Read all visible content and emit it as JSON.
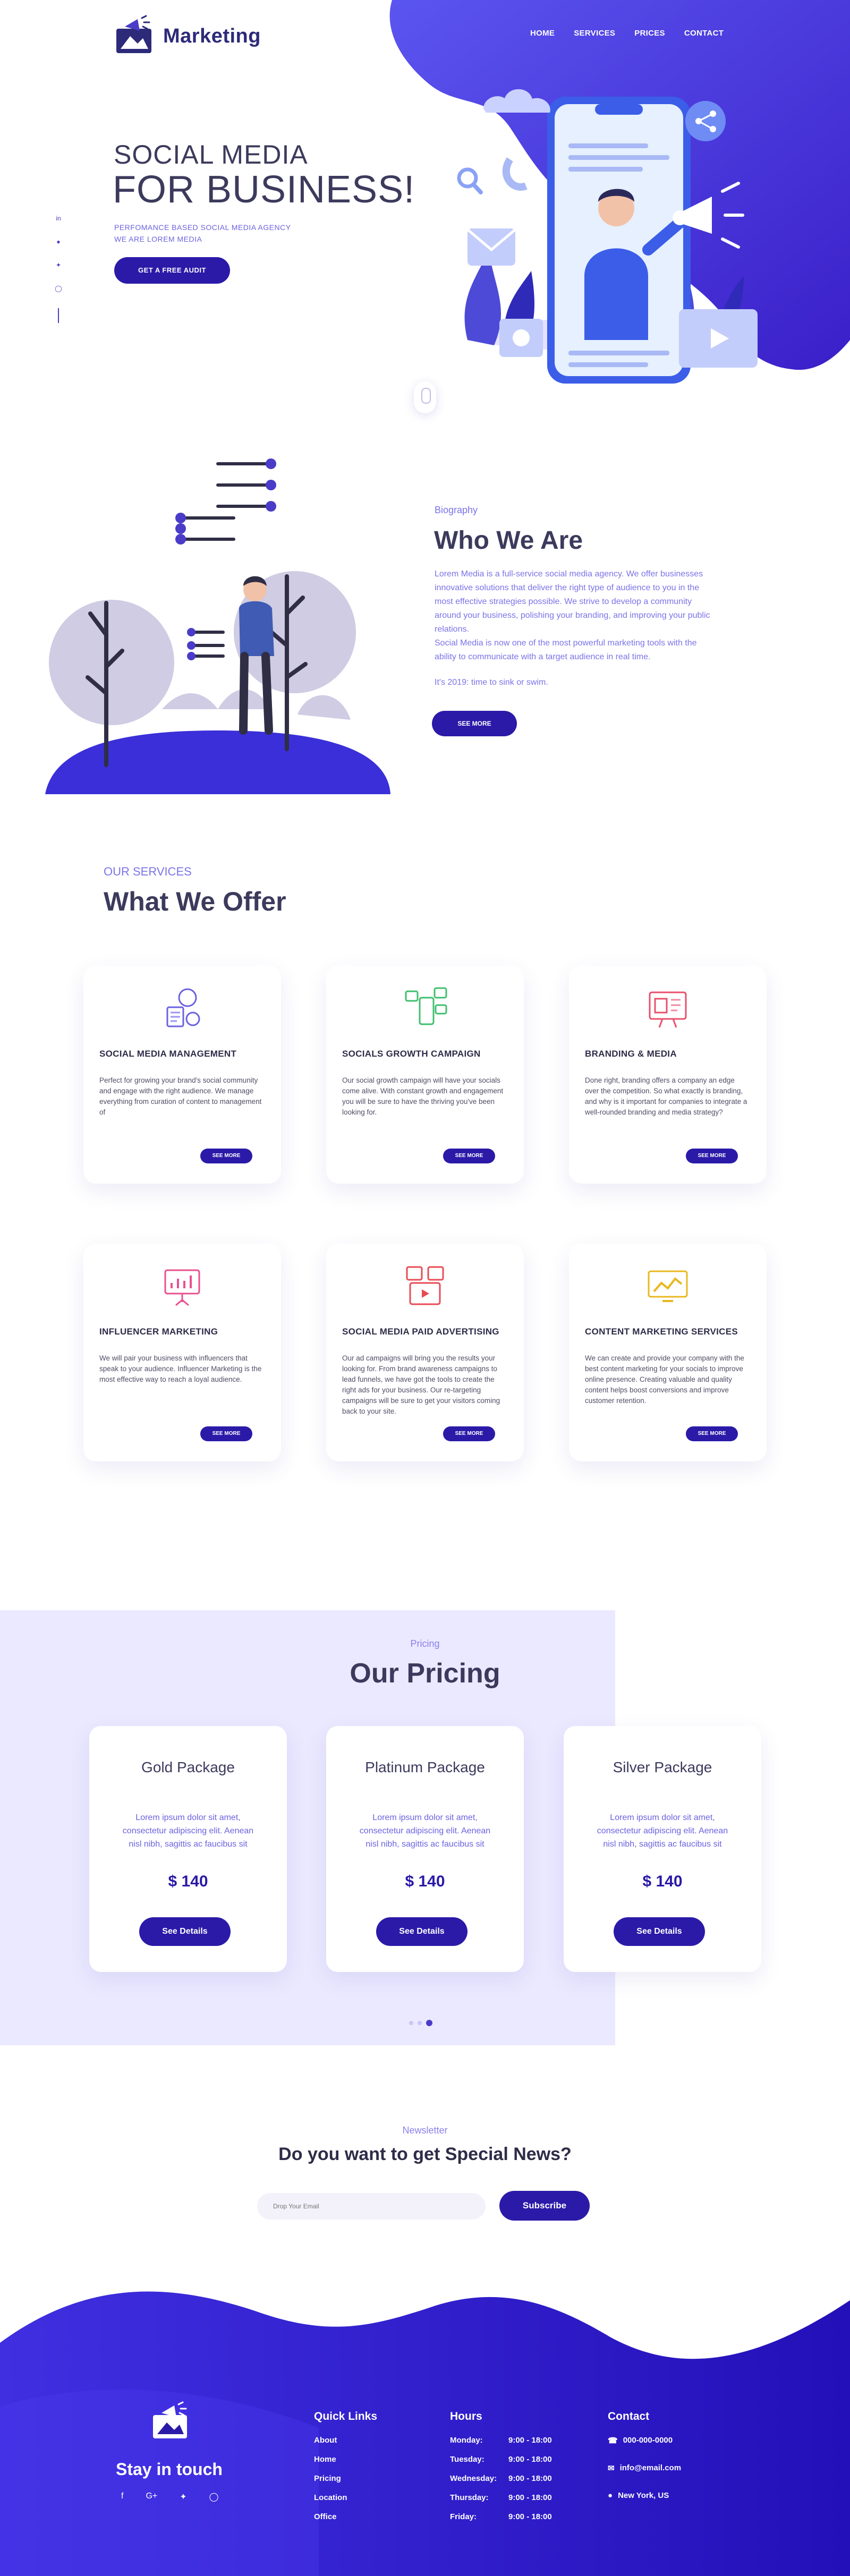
{
  "brand": {
    "name": "Marketing"
  },
  "nav": [
    "HOME",
    "SERVICES",
    "PRICES",
    "CONTACT"
  ],
  "hero": {
    "title_line1": "SOCIAL MEDIA",
    "title_line2": "FOR BUSINESS!",
    "subtitle_line1": "PERFOMANCE BASED SOCIAL MEDIA AGENCY",
    "subtitle_line2": "WE ARE LOREM MEDIA",
    "cta": "GET A FREE AUDIT"
  },
  "about": {
    "label": "Biography",
    "title": "Who We Are",
    "paragraph1": "Lorem Media is a full-service social media agency. We offer businesses innovative solutions that deliver the right type of audience to you in the most effective strategies possible. We strive to develop a community around your business, polishing your branding, and improving your public relations.",
    "paragraph2": "Social Media is now one of the most powerful marketing tools with the ability to communicate with a target audience in real time.",
    "paragraph3": "It's 2019: time to sink or swim.",
    "cta": "SEE MORE"
  },
  "services": {
    "label": "OUR SERVICES",
    "title": "What We Offer",
    "items": [
      {
        "name": "SOCIAL MEDIA MANAGEMENT",
        "desc": "Perfect for growing your brand's social community and engage with the right audience. We manage everything from curation of content to management of",
        "cta": "SEE MORE",
        "icon": "social-management-icon",
        "color": "#6b62e0"
      },
      {
        "name": "SOCIALS GROWTH CAMPAIGN",
        "desc": "Our social growth campaign will have your socials come alive. With constant growth and engagement you will be sure to have the thriving you've been looking for.",
        "cta": "SEE MORE",
        "icon": "growth-campaign-icon",
        "color": "#3fbf6e"
      },
      {
        "name": "BRANDING & MEDIA",
        "desc": "Done right, branding offers a company an edge over the competition. So what exactly is branding, and why is it important for companies to integrate a well-rounded branding and media strategy?",
        "cta": "SEE MORE",
        "icon": "branding-icon",
        "color": "#e8506b"
      },
      {
        "name": "INFLUENCER MARKETING",
        "desc": "We will pair your business with influencers that speak to your audience. Influencer Marketing is the most effective way to reach a loyal audience.",
        "cta": "SEE MORE",
        "icon": "influencer-icon",
        "color": "#e8508f"
      },
      {
        "name": "SOCIAL MEDIA PAID ADVERTISING",
        "desc": "Our ad campaigns will bring you the results your looking for. From brand awareness campaigns to lead funnels, we have got the tools to create the right ads for your business. Our re-targeting campaigns will be sure to get your visitors coming back to your site.",
        "cta": "SEE MORE",
        "icon": "paid-ads-icon",
        "color": "#e84b55"
      },
      {
        "name": "CONTENT MARKETING SERVICES",
        "desc": "We can create and provide your company with the best content marketing for your socials to improve online presence. Creating valuable and quality content helps boost conversions and improve customer retention.",
        "cta": "SEE MORE",
        "icon": "content-marketing-icon",
        "color": "#e8b820"
      }
    ]
  },
  "pricing": {
    "label": "Pricing",
    "title": "Our Pricing",
    "plans": [
      {
        "name": "Gold Package",
        "desc": "Lorem ipsum dolor sit amet, consectetur adipiscing elit. Aenean nisl nibh, sagittis ac faucibus sit",
        "price": "$ 140",
        "cta": "See Details"
      },
      {
        "name": "Platinum Package",
        "desc": "Lorem ipsum dolor sit amet, consectetur adipiscing elit. Aenean nisl nibh, sagittis ac faucibus sit",
        "price": "$ 140",
        "cta": "See Details"
      },
      {
        "name": "Silver Package",
        "desc": "Lorem ipsum dolor sit amet, consectetur adipiscing elit. Aenean nisl nibh, sagittis ac faucibus sit",
        "price": "$ 140",
        "cta": "See Details"
      }
    ]
  },
  "newsletter": {
    "label": "Newsletter",
    "title_prefix": "Do you want to get ",
    "title_bold": "Special News?",
    "placeholder": "Drop Your Email",
    "cta": "Subscribe"
  },
  "footer": {
    "tagline": "Stay in touch",
    "social_icons": [
      "facebook-icon",
      "google-icon",
      "twitter-icon",
      "instagram-icon"
    ],
    "quick_links": {
      "title": "Quick Links",
      "items": [
        "About",
        "Home",
        "Pricing",
        "Location",
        "Office"
      ]
    },
    "hours": {
      "title": "Hours",
      "rows": [
        {
          "day": "Monday:",
          "time": "9:00 - 18:00"
        },
        {
          "day": "Tuesday:",
          "time": "9:00 - 18:00"
        },
        {
          "day": "Wednesday:",
          "time": "9:00 - 18:00"
        },
        {
          "day": "Thursday:",
          "time": "9:00 - 18:00"
        },
        {
          "day": "Friday:",
          "time": "9:00 - 18:00"
        }
      ]
    },
    "contact": {
      "title": "Contact",
      "phone": "000-000-0000",
      "email": "info@email.com",
      "location": "New York, US"
    }
  },
  "colors": {
    "primary": "#2b1aa8",
    "accent": "#6b62e0",
    "heading": "#3c3a5c",
    "pricing_bg": "#ebe9ff"
  }
}
